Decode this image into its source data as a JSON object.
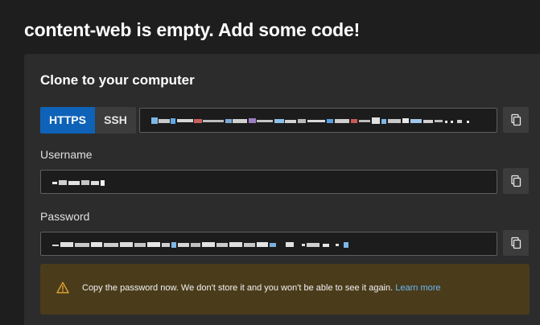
{
  "page": {
    "title": "content-web is empty. Add some code!"
  },
  "clone": {
    "section_title": "Clone to your computer",
    "protocols": [
      {
        "label": "HTTPS",
        "selected": true
      },
      {
        "label": "SSH",
        "selected": false
      }
    ],
    "username_label": "Username",
    "password_label": "Password"
  },
  "warning": {
    "icon": "warning-icon",
    "message": "Copy the password now. We don't store it and you won't be able to see it again.",
    "link_label": "Learn more"
  },
  "colors": {
    "accent": "#0e63b8",
    "panel": "#2d2c2c",
    "warning_bg": "#4a3c1b",
    "warning_icon": "#e4a430",
    "link": "#6cb8f6"
  },
  "icons": {
    "copy": "copy-icon"
  }
}
